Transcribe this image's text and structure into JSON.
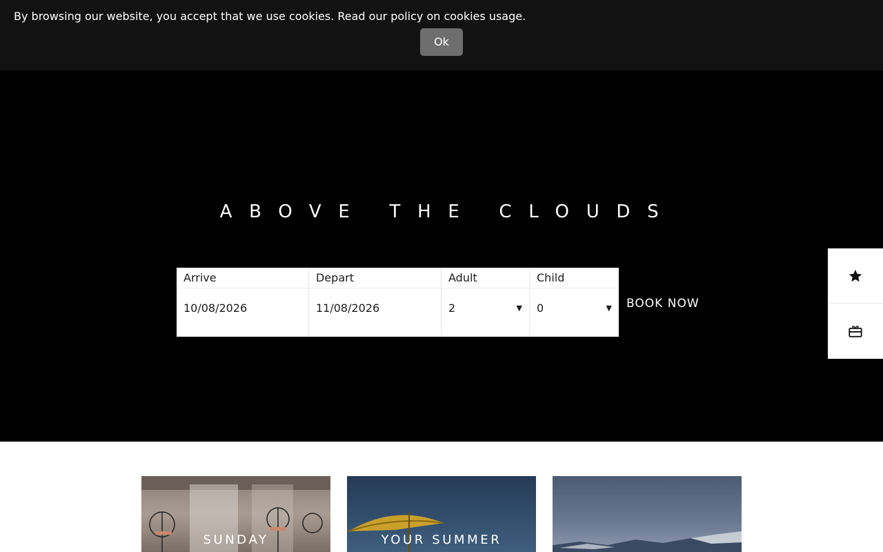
{
  "cookie_banner": {
    "message": "By browsing our website, you accept that we use cookies. Read our policy on cookies usage.",
    "ok_label": "Ok"
  },
  "hero": {
    "title": "ABOVE THE CLOUDS"
  },
  "booking": {
    "arrive_label": "Arrive",
    "arrive_value": "10/08/2026",
    "depart_label": "Depart",
    "depart_value": "11/08/2026",
    "adult_label": "Adult",
    "adult_value": "2",
    "child_label": "Child",
    "child_value": "0",
    "book_now_label": "BOOK NOW"
  },
  "side_tabs": {
    "icons": [
      "star-icon",
      "gift-card-icon"
    ]
  },
  "cards": [
    {
      "title": "SUNDAY"
    },
    {
      "title": "YOUR SUMMER"
    },
    {
      "title": ""
    }
  ],
  "colors": {
    "cookie_bg": "#121212",
    "ok_button_bg": "#6e6e6e",
    "hero_bg": "#000000",
    "text_light": "#ffffff"
  }
}
